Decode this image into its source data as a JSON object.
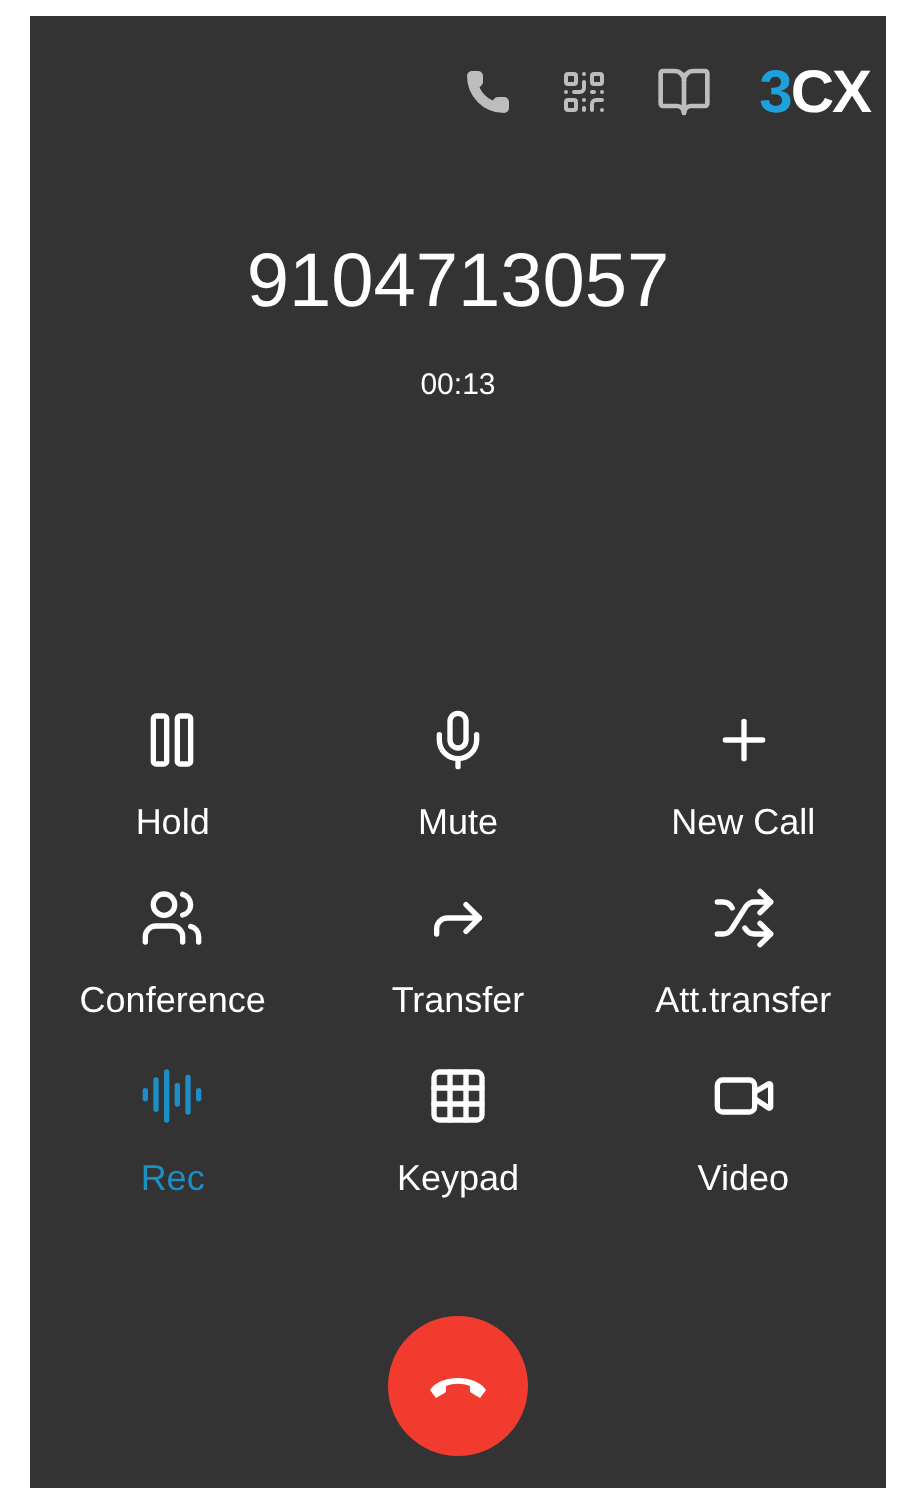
{
  "toolbar": {
    "logo": {
      "accent": "3",
      "rest": "CX"
    }
  },
  "call": {
    "number": "9104713057",
    "duration": "00:13"
  },
  "actions": [
    {
      "kind": "hold",
      "label": "Hold",
      "active": false
    },
    {
      "kind": "mute",
      "label": "Mute",
      "active": false
    },
    {
      "kind": "new_call",
      "label": "New Call",
      "active": false
    },
    {
      "kind": "conference",
      "label": "Conference",
      "active": false
    },
    {
      "kind": "transfer",
      "label": "Transfer",
      "active": false
    },
    {
      "kind": "att_transfer",
      "label": "Att.transfer",
      "active": false
    },
    {
      "kind": "rec",
      "label": "Rec",
      "active": true
    },
    {
      "kind": "keypad",
      "label": "Keypad",
      "active": false
    },
    {
      "kind": "video",
      "label": "Video",
      "active": false
    }
  ]
}
